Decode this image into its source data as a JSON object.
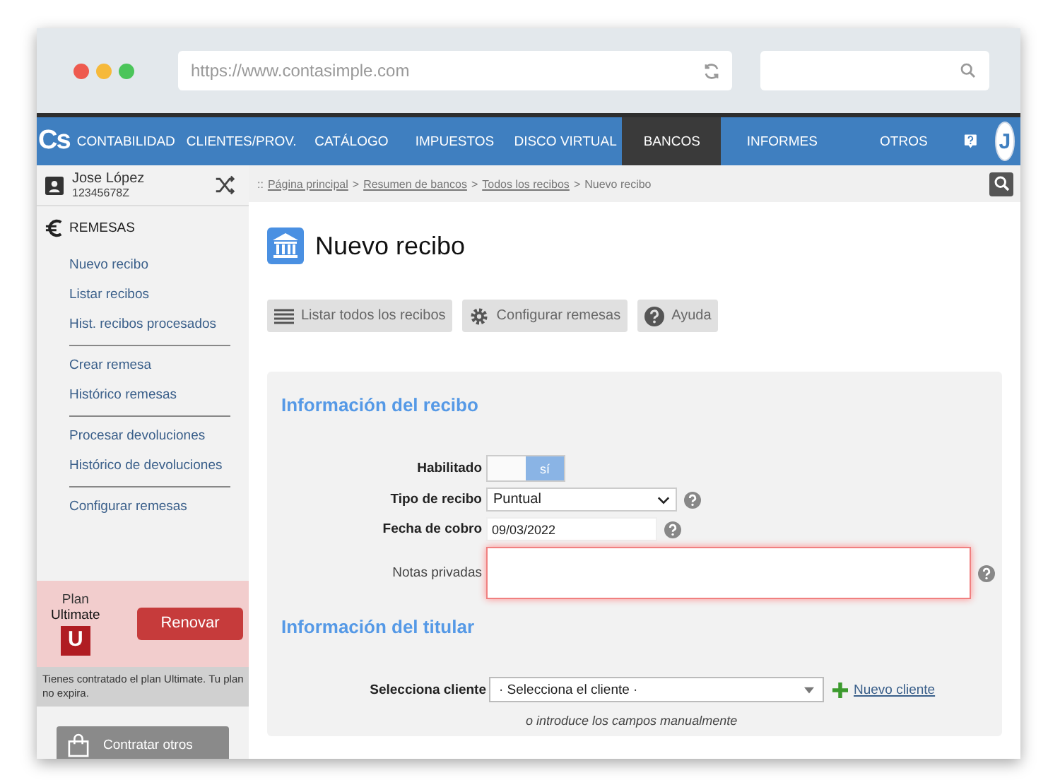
{
  "browser": {
    "url": "https://www.contasimple.com"
  },
  "nav": {
    "logo": "Cs",
    "avatar": "J",
    "items": [
      {
        "label": "CONTABILIDAD",
        "selected": false
      },
      {
        "label": "CLIENTES/PROV.",
        "selected": false
      },
      {
        "label": "CATÁLOGO",
        "selected": false
      },
      {
        "label": "IMPUESTOS",
        "selected": false
      },
      {
        "label": "DISCO VIRTUAL",
        "selected": false
      },
      {
        "label": "BANCOS",
        "selected": true
      },
      {
        "label": "INFORMES",
        "selected": false
      },
      {
        "label": "OTROS",
        "selected": false
      }
    ]
  },
  "sidebar": {
    "user": {
      "name": "Jose López",
      "id": "12345678Z"
    },
    "section": "REMESAS",
    "groups": [
      [
        "Nuevo recibo",
        "Listar recibos",
        "Hist. recibos procesados"
      ],
      [
        "Crear remesa",
        "Histórico remesas"
      ],
      [
        "Procesar devoluciones",
        "Histórico de devoluciones"
      ],
      [
        "Configurar remesas"
      ]
    ],
    "plan": {
      "label": "Plan",
      "name": "Ultimate",
      "badge": "U",
      "button": "Renovar",
      "note": "Tienes contratado el plan Ultimate. Tu plan no expira."
    },
    "shop_button": "Contratar otros"
  },
  "main": {
    "breadcrumb": [
      {
        "text": "::",
        "kind": "sep"
      },
      {
        "text": "Página principal",
        "kind": "link"
      },
      {
        "text": ">",
        "kind": "sep"
      },
      {
        "text": "Resumen de bancos",
        "kind": "link"
      },
      {
        "text": ">",
        "kind": "sep"
      },
      {
        "text": "Todos los recibos",
        "kind": "link"
      },
      {
        "text": ">",
        "kind": "sep"
      },
      {
        "text": "Nuevo recibo",
        "kind": "current"
      }
    ],
    "title": "Nuevo recibo",
    "toolbar": [
      {
        "label": "Listar todos los recibos",
        "kind": "list"
      },
      {
        "label": "Configurar remesas",
        "kind": "gear"
      },
      {
        "label": "Ayuda",
        "kind": "help"
      }
    ],
    "section_1": {
      "heading": "Información del recibo",
      "fields": [
        {
          "kind": "toggle",
          "label": "Habilitado",
          "value": "sí",
          "on": true
        },
        {
          "kind": "select",
          "label": "Tipo de recibo",
          "value": "Puntual",
          "help": true
        },
        {
          "kind": "date",
          "label": "Fecha de cobro",
          "value": "09/03/2022",
          "help": true
        },
        {
          "kind": "textarea",
          "label": "Notas privadas",
          "error": true,
          "help": true
        }
      ]
    },
    "section_2": {
      "heading": "Información del titular",
      "client_label": "Selecciona cliente",
      "client_value": "· Selecciona el cliente ·",
      "new_client": "Nuevo cliente",
      "manual_hint": "o introduce los campos manualmente"
    }
  }
}
